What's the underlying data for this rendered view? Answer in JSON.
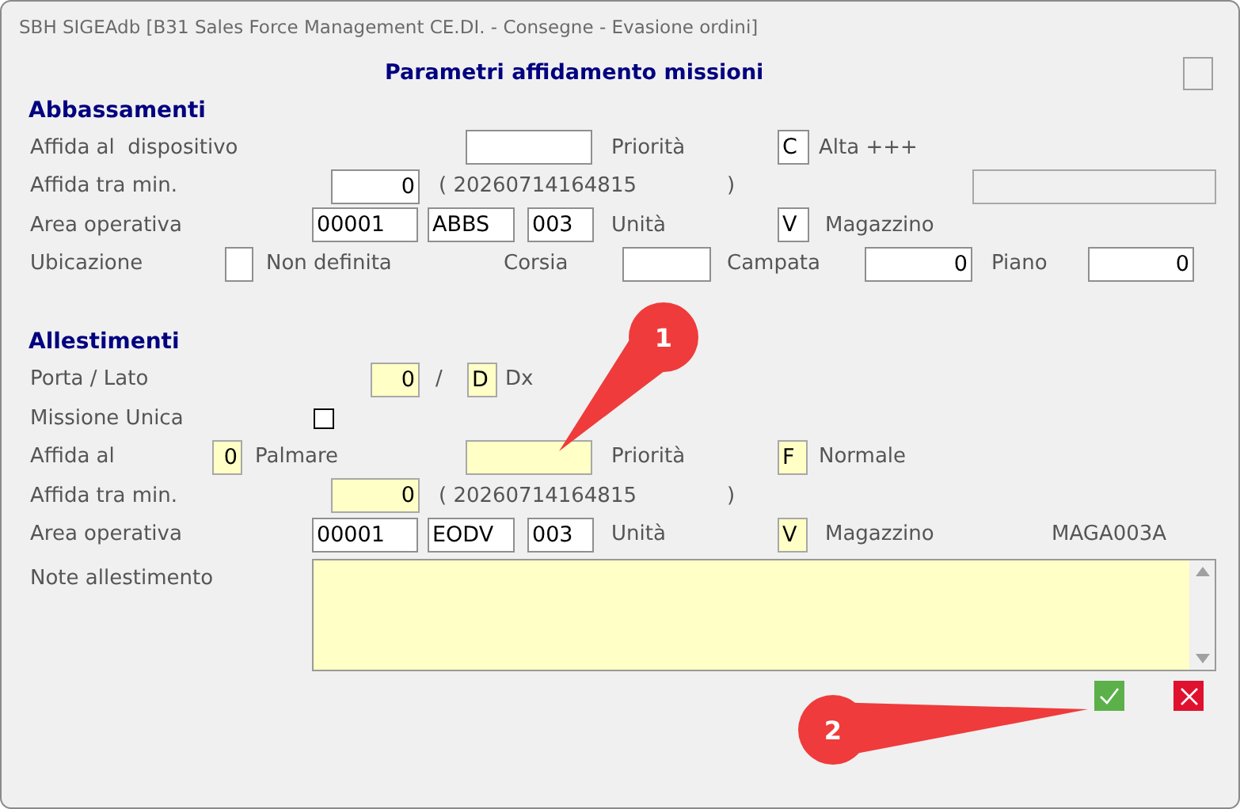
{
  "window": {
    "title": "SBH SIGEAdb [B31 Sales Force Management CE.DI. - Consegne - Evasione ordini]"
  },
  "header": {
    "title": "Parametri affidamento missioni"
  },
  "sections": [
    {
      "title": "Abbassamenti",
      "rows": [
        {
          "items": [
            {
              "kind": "label",
              "text": "Affida al  dispositivo"
            },
            {
              "kind": "field",
              "highlighted": false,
              "disabled": false
            },
            {
              "kind": "label",
              "text": "Priorità"
            },
            {
              "kind": "field",
              "value": "C",
              "highlighted": false,
              "disabled": false
            },
            {
              "kind": "label",
              "text": "Alta +++"
            }
          ]
        },
        {
          "items": [
            {
              "kind": "label",
              "text": "Affida tra min."
            },
            {
              "kind": "number",
              "value": "0",
              "highlighted": false,
              "disabled": false
            },
            {
              "kind": "label",
              "text": "( 20260714164815"
            },
            {
              "kind": "label",
              "text": ")"
            },
            {
              "kind": "field",
              "highlighted": false,
              "disabled": true
            }
          ]
        },
        {
          "items": [
            {
              "kind": "label",
              "text": "Area operativa"
            },
            {
              "kind": "field",
              "value": "00001",
              "highlighted": false,
              "disabled": false
            },
            {
              "kind": "field",
              "value": "ABBS",
              "highlighted": false,
              "disabled": false
            },
            {
              "kind": "field",
              "value": "003",
              "highlighted": false,
              "disabled": false
            },
            {
              "kind": "label",
              "text": "Unità"
            },
            {
              "kind": "field",
              "value": "V",
              "highlighted": false,
              "disabled": false
            },
            {
              "kind": "label",
              "text": "Magazzino"
            }
          ]
        },
        {
          "items": [
            {
              "kind": "label",
              "text": "Ubicazione"
            },
            {
              "kind": "field",
              "highlighted": false,
              "disabled": false
            },
            {
              "kind": "label",
              "text": "Non definita"
            },
            {
              "kind": "label",
              "text": "Corsia"
            },
            {
              "kind": "field",
              "highlighted": false,
              "disabled": false
            },
            {
              "kind": "label",
              "text": "Campata"
            },
            {
              "kind": "number",
              "value": "0",
              "highlighted": false,
              "disabled": false
            },
            {
              "kind": "label",
              "text": "Piano"
            },
            {
              "kind": "number",
              "value": "0",
              "highlighted": false,
              "disabled": false
            }
          ]
        }
      ]
    },
    {
      "title": "Allestimenti",
      "rows": [
        {
          "items": [
            {
              "kind": "label",
              "text": "Porta / Lato"
            },
            {
              "kind": "number",
              "value": "0",
              "highlighted": true,
              "disabled": false
            },
            {
              "kind": "label",
              "text": "/"
            },
            {
              "kind": "field",
              "value": "D",
              "highlighted": true,
              "disabled": false
            },
            {
              "kind": "label",
              "text": "Dx"
            }
          ]
        },
        {
          "items": [
            {
              "kind": "label",
              "text": "Missione Unica"
            },
            {
              "kind": "checkbox",
              "checked": false
            }
          ]
        },
        {
          "items": [
            {
              "kind": "label",
              "text": "Affida al"
            },
            {
              "kind": "number",
              "value": "0",
              "highlighted": true,
              "disabled": false
            },
            {
              "kind": "label",
              "text": "Palmare"
            },
            {
              "kind": "field",
              "highlighted": true,
              "disabled": false
            },
            {
              "kind": "label",
              "text": "Priorità"
            },
            {
              "kind": "field",
              "value": "F",
              "highlighted": true,
              "disabled": false
            },
            {
              "kind": "label",
              "text": "Normale"
            }
          ]
        },
        {
          "items": [
            {
              "kind": "label",
              "text": "Affida tra min."
            },
            {
              "kind": "number",
              "value": "0",
              "highlighted": true,
              "disabled": false
            },
            {
              "kind": "label",
              "text": "( 20260714164815"
            },
            {
              "kind": "label",
              "text": ")"
            }
          ]
        },
        {
          "items": [
            {
              "kind": "label",
              "text": "Area operativa"
            },
            {
              "kind": "field",
              "value": "00001",
              "highlighted": false,
              "disabled": false
            },
            {
              "kind": "field",
              "value": "EODV",
              "highlighted": false,
              "disabled": false
            },
            {
              "kind": "field",
              "value": "003",
              "highlighted": false,
              "disabled": false
            },
            {
              "kind": "label",
              "text": "Unità"
            },
            {
              "kind": "field",
              "value": "V",
              "highlighted": true,
              "disabled": false
            },
            {
              "kind": "label",
              "text": "Magazzino"
            },
            {
              "kind": "label",
              "text": "MAGA003A"
            }
          ]
        }
      ]
    }
  ],
  "note": {
    "label": "Note allestimento",
    "highlighted": true
  },
  "buttons": [
    {
      "kind": "confirm"
    },
    {
      "kind": "cancel"
    }
  ],
  "annotations": [
    {
      "label": "1"
    },
    {
      "label": "2"
    }
  ]
}
